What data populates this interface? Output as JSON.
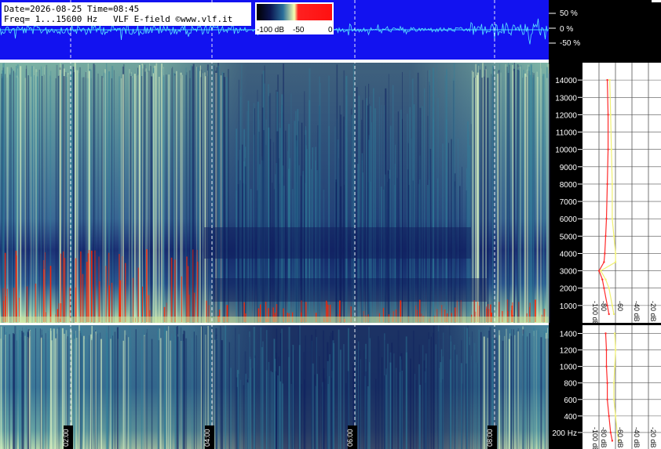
{
  "header": {
    "line1": "Date=2026-08-25 Time=08:45",
    "line2": "Freq= 1...15000 Hz   VLF E-field ©www.vlf.it"
  },
  "colorbar": {
    "ticks": [
      "-100 dB",
      "-50",
      "0"
    ],
    "min_db": -100,
    "max_db": 0
  },
  "waveform": {
    "ticks": [
      "50 %",
      "0 %",
      "-50 %"
    ],
    "values_percent": [
      50,
      0,
      -50
    ]
  },
  "colors": {
    "waveform_bg": "#1212f0",
    "waveform_trace": "#5ae8ff",
    "spectrogram_low": "#0c1c5c",
    "spectrogram_mid": "#2f7f9a",
    "spectrogram_high": "#d8f0c0",
    "spectrogram_peak": "#ff2200",
    "avg_trace": "#ff2a2a",
    "max_trace": "#f0f070",
    "panel_bg": "#ffffff"
  },
  "chart_data": [
    {
      "type": "heatmap",
      "title": "",
      "xlabel": "",
      "ylabel": "",
      "ylim": [
        0,
        15000
      ],
      "y_ticks": [
        1000,
        2000,
        3000,
        4000,
        5000,
        6000,
        7000,
        8000,
        9000,
        10000,
        11000,
        12000,
        13000,
        14000
      ],
      "y_tick_labels": [
        "1000",
        "2000",
        "3000",
        "4000",
        "5000",
        "6000",
        "7000",
        "8000",
        "9000",
        "10000",
        "11000",
        "12000",
        "13000",
        "14000"
      ],
      "x_time_markers": [
        "02:00",
        "04:00",
        "06:00",
        "08:00"
      ]
    },
    {
      "type": "heatmap",
      "title": "",
      "xlabel": "",
      "ylabel": "",
      "ylim": [
        0,
        1500
      ],
      "y_ticks": [
        200,
        400,
        600,
        800,
        1000,
        1200,
        1400
      ],
      "y_tick_labels": [
        "200 Hz",
        "400",
        "600",
        "800",
        "1000",
        "1200",
        "1400"
      ],
      "x_time_markers": [
        "02:00",
        "04:00",
        "06:00",
        "08:00"
      ]
    },
    {
      "type": "line",
      "title": "",
      "x_tick_labels": [
        "-100 dB",
        "-80",
        "-60",
        "-40 dB",
        "-20 dB"
      ],
      "xlim": [
        -110,
        -15
      ],
      "series": [
        {
          "values_freq": [
            500,
            1000,
            2000,
            2500,
            3000,
            3500,
            4000,
            5000,
            6000,
            8000,
            10000,
            12000,
            14000
          ],
          "values_db": [
            -78,
            -80,
            -84,
            -86,
            -90,
            -84,
            -83,
            -82,
            -81,
            -80,
            -79,
            -79,
            -80
          ]
        },
        {
          "values_freq": [
            500,
            1000,
            2000,
            2500,
            3000,
            3500,
            4000,
            5000,
            6000,
            8000,
            10000,
            12000,
            14000
          ],
          "values_db": [
            -72,
            -74,
            -78,
            -82,
            -88,
            -70,
            -70,
            -72,
            -74,
            -74,
            -75,
            -76,
            -77
          ]
        }
      ]
    },
    {
      "type": "line",
      "title": "",
      "x_tick_labels": [
        "-100 dB",
        "-80 dB",
        "-60 dB",
        "-40 dB",
        "-20 dB"
      ],
      "xlim": [
        -110,
        -15
      ],
      "series": [
        {
          "values_freq": [
            100,
            200,
            400,
            600,
            800,
            1000,
            1200,
            1400
          ],
          "values_db": [
            -74,
            -76,
            -78,
            -80,
            -80,
            -81,
            -81,
            -82
          ]
        },
        {
          "values_freq": [
            100,
            200,
            400,
            600,
            800,
            1000,
            1200,
            1400
          ],
          "values_db": [
            -66,
            -68,
            -70,
            -72,
            -72,
            -71,
            -70,
            -71
          ]
        }
      ]
    }
  ]
}
